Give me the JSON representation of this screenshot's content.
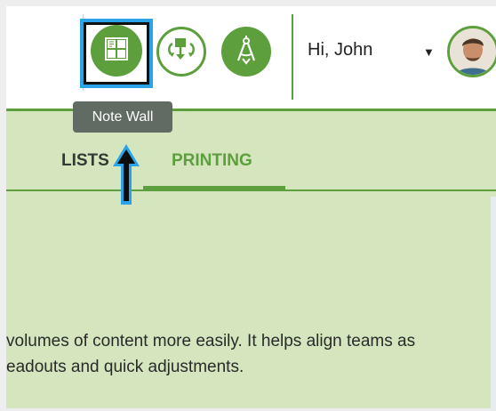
{
  "header": {
    "toolbar": [
      {
        "name": "note-wall",
        "icon": "note-wall-icon"
      },
      {
        "name": "transfer",
        "icon": "transfer-icon"
      },
      {
        "name": "compass",
        "icon": "compass-icon"
      }
    ],
    "greeting": "Hi, John",
    "user_menu_caret": "▼",
    "avatar_icon": "user-avatar"
  },
  "tooltip": "Note Wall",
  "tabs": [
    {
      "label": "LISTS",
      "active": false
    },
    {
      "label": "PRINTING",
      "active": true
    }
  ],
  "body": {
    "line1": "volumes of content more easily. It helps align teams as",
    "line2": "eadouts and quick adjustments.",
    "line3": "                                                  "
  },
  "colors": {
    "accent": "#5e9f3d",
    "content_bg": "#d5e6bf",
    "tooltip_bg": "#5f6b63",
    "highlight": "#2aa3e8"
  }
}
